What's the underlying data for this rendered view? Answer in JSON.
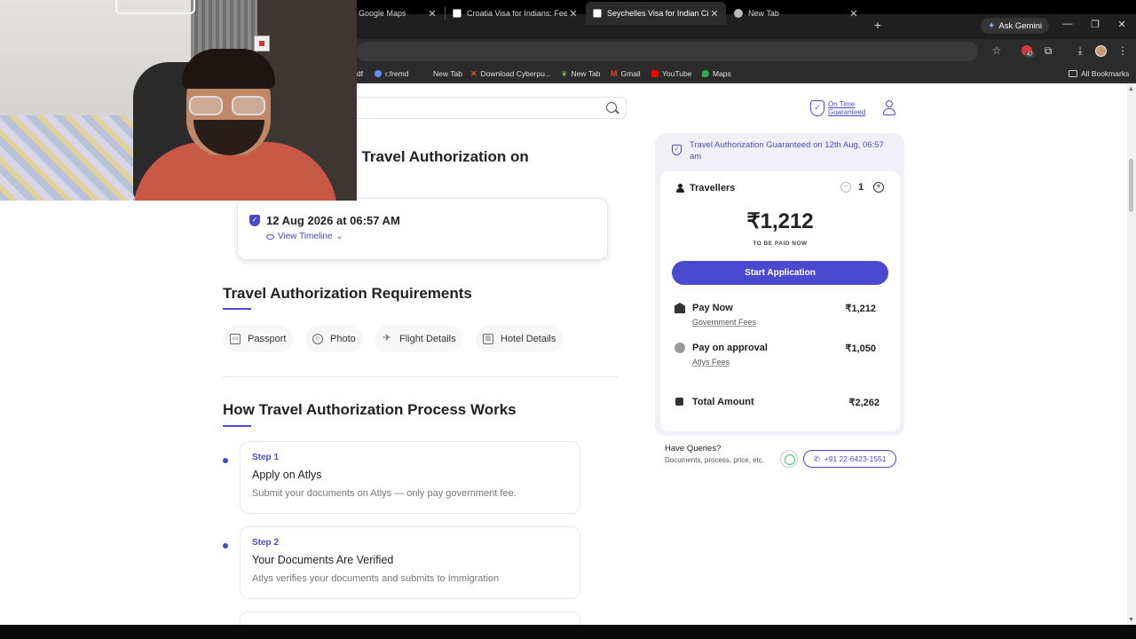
{
  "browser": {
    "tabs": [
      {
        "title": "Google Maps",
        "active": false
      },
      {
        "title": "Croatia Visa for Indians: Fees, D",
        "active": false
      },
      {
        "title": "Seychelles Visa for Indian Citize",
        "active": true
      },
      {
        "title": "New Tab",
        "active": false
      }
    ],
    "new_tab_symbol": "+",
    "gemini_label": "Ask Gemini",
    "extension_badge": "47",
    "bookmarks": [
      {
        "label": "df",
        "icon": "doc-icon"
      },
      {
        "label": "r.fremd",
        "icon": "r-icon"
      },
      {
        "label": "New Tab",
        "icon": "tab-icon"
      },
      {
        "label": "Download Cyberpu...",
        "icon": "x-logo-icon"
      },
      {
        "label": "New Tab",
        "icon": "leaf-icon"
      },
      {
        "label": "Gmail",
        "icon": "gmail-icon"
      },
      {
        "label": "YouTube",
        "icon": "youtube-icon"
      },
      {
        "label": "Maps",
        "icon": "maps-icon"
      }
    ],
    "all_bookmarks_label": "All Bookmarks"
  },
  "header": {
    "on_time_line1": "On Time",
    "on_time_line2": "Guaranteed"
  },
  "main": {
    "heading_partial": "l Travel Authorization on",
    "date_card": {
      "date_text": "12 Aug 2026 at 06:57 AM",
      "view_timeline": "View Timeline"
    },
    "requirements_title": "Travel Authorization Requirements",
    "requirements": [
      {
        "label": "Passport",
        "icon": "passport-icon"
      },
      {
        "label": "Photo",
        "icon": "photo-icon"
      },
      {
        "label": "Flight Details",
        "icon": "flight-icon"
      },
      {
        "label": "Hotel Details",
        "icon": "hotel-icon"
      }
    ],
    "process_title": "How Travel Authorization Process Works",
    "steps": [
      {
        "num": "Step 1",
        "title": "Apply on Atlys",
        "desc": "Submit your documents on Atlys — only pay government fee."
      },
      {
        "num": "Step 2",
        "title": "Your Documents Are Verified",
        "desc": "Atlys verifies your documents and submits to Immigration"
      }
    ]
  },
  "pricing": {
    "guarantee_text": "Travel Authorization Guaranteed on 12th Aug, 06:57 am",
    "travellers_label": "Travellers",
    "travellers_count": "1",
    "price": "₹1,212",
    "price_caption": "TO BE PAID NOW",
    "start_button": "Start Application",
    "pay_now_title": "Pay Now",
    "pay_now_sub": "Government Fees",
    "pay_now_amount": "₹1,212",
    "pay_approval_title": "Pay on approval",
    "pay_approval_sub": "Atlys Fees",
    "pay_approval_amount": "₹1,050",
    "total_title": "Total Amount",
    "total_amount": "₹2,262"
  },
  "support": {
    "title": "Have Queries?",
    "subtitle": "Documents, process, price, etc.",
    "phone": "+91 22-6423-1551"
  },
  "colors": {
    "accent": "#4a4ac8",
    "button": "#4a4ad0",
    "chrome_dark": "#1f1f1f"
  }
}
